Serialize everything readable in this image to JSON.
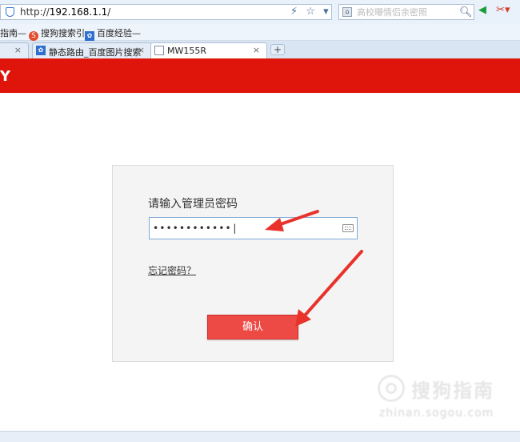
{
  "browser": {
    "address": {
      "scheme": "http://",
      "host": "192.168.1.1",
      "path": "/"
    },
    "address_tools": {
      "lightning": "⚡",
      "star": "☆",
      "dropdown": "▾"
    },
    "search": {
      "placeholder": "高校曝情侣余密照",
      "engine_glyph": "🐾"
    },
    "right_tools": {
      "green": "◀",
      "red": "✂▾"
    },
    "favorites": [
      {
        "label": "指南—"
      },
      {
        "label": "搜狗搜索引"
      },
      {
        "label": "百度经验—"
      }
    ],
    "tabs": [
      {
        "label": "静态路由_百度图片搜索",
        "close": "×"
      },
      {
        "label": "MW155R",
        "close": "×",
        "active": true
      }
    ],
    "first_tab_close": "×",
    "new_tab": "+"
  },
  "page": {
    "logo_fragment": "Y",
    "login": {
      "prompt": "请输入管理员密码",
      "password_value": "••••••••••••|",
      "forgot_label": "忘记密码？",
      "confirm_label": "确认"
    }
  },
  "watermark": {
    "brand": "搜狗指南",
    "url": "zhinan.sogou.com"
  },
  "colors": {
    "banner": "#df150c",
    "button": "#ee4a45",
    "arrow": "#e8322b",
    "chrome": "#e9f1fb"
  }
}
